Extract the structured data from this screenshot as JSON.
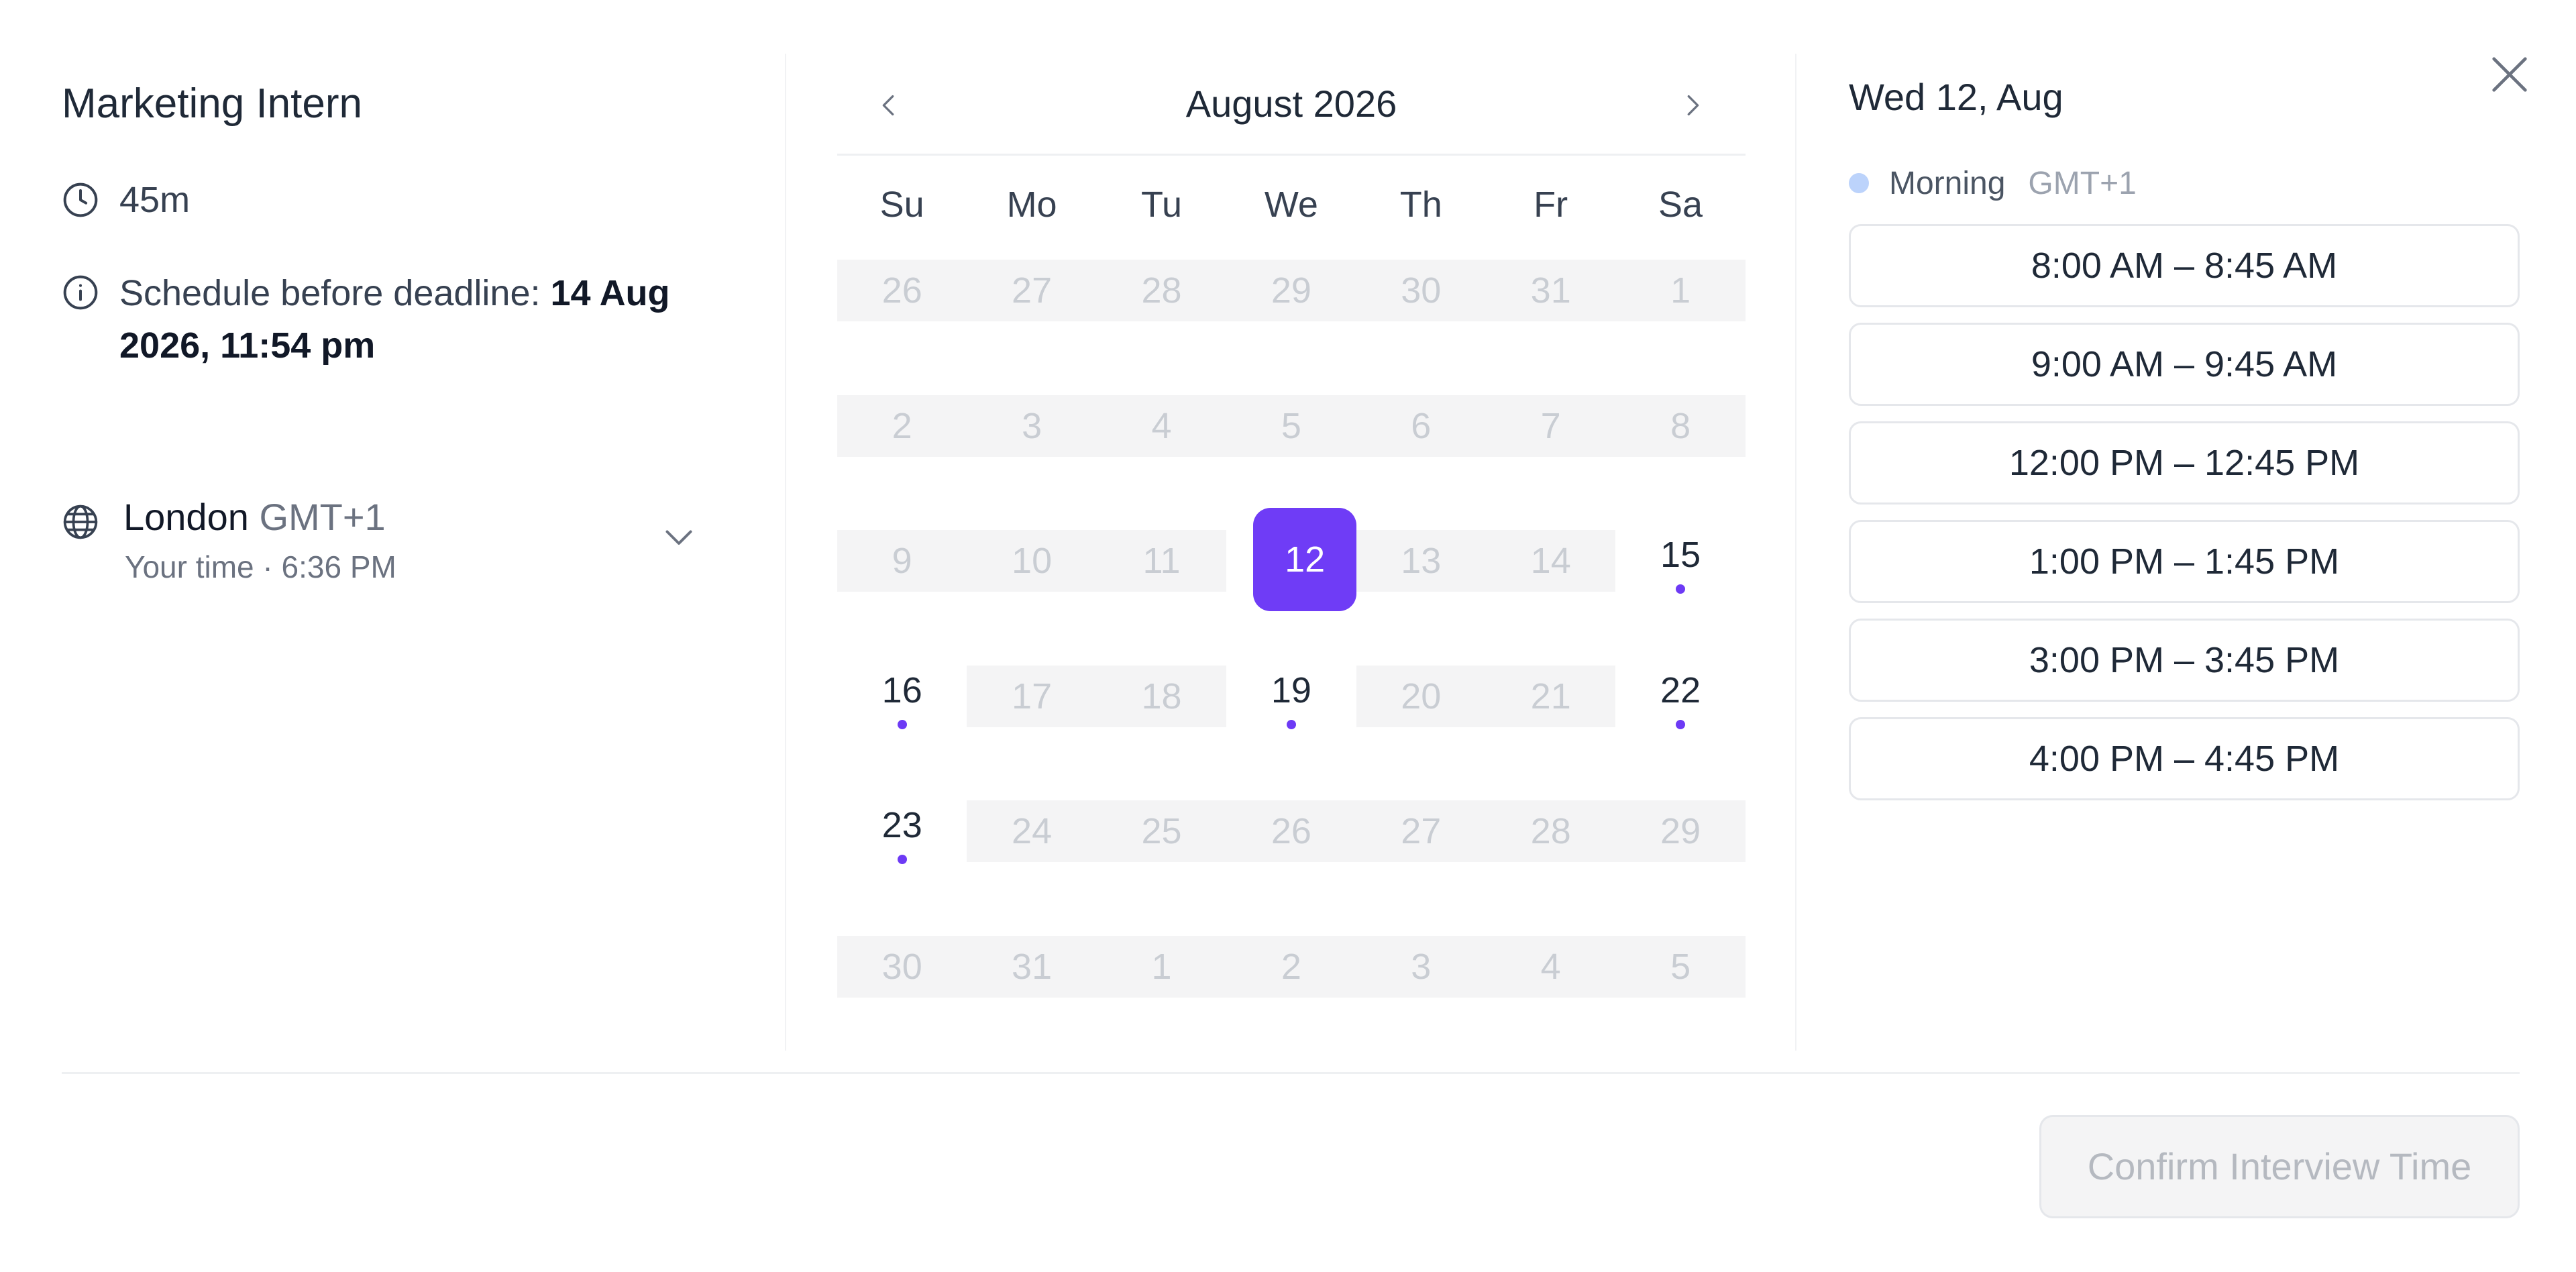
{
  "job": {
    "title": "Marketing Intern",
    "duration": "45m",
    "deadline_label": "Schedule before deadline: ",
    "deadline_value": "14 Aug 2026, 11:54 pm"
  },
  "timezone": {
    "city": "London",
    "offset": "GMT+1",
    "local_time": "Your time · 6:36 PM"
  },
  "calendar": {
    "month_title": "August 2026",
    "weekdays": [
      "Su",
      "Mo",
      "Tu",
      "We",
      "Th",
      "Fr",
      "Sa"
    ],
    "weeks": [
      [
        {
          "label": "26",
          "state": "disabled"
        },
        {
          "label": "27",
          "state": "disabled"
        },
        {
          "label": "28",
          "state": "disabled"
        },
        {
          "label": "29",
          "state": "disabled"
        },
        {
          "label": "30",
          "state": "disabled"
        },
        {
          "label": "31",
          "state": "disabled"
        },
        {
          "label": "1",
          "state": "disabled"
        }
      ],
      [
        {
          "label": "2",
          "state": "disabled"
        },
        {
          "label": "3",
          "state": "disabled"
        },
        {
          "label": "4",
          "state": "disabled"
        },
        {
          "label": "5",
          "state": "disabled"
        },
        {
          "label": "6",
          "state": "disabled"
        },
        {
          "label": "7",
          "state": "disabled"
        },
        {
          "label": "8",
          "state": "disabled"
        }
      ],
      [
        {
          "label": "9",
          "state": "disabled"
        },
        {
          "label": "10",
          "state": "disabled"
        },
        {
          "label": "11",
          "state": "disabled"
        },
        {
          "label": "12",
          "state": "selected"
        },
        {
          "label": "13",
          "state": "disabled"
        },
        {
          "label": "14",
          "state": "disabled"
        },
        {
          "label": "15",
          "state": "available"
        }
      ],
      [
        {
          "label": "16",
          "state": "available"
        },
        {
          "label": "17",
          "state": "disabled"
        },
        {
          "label": "18",
          "state": "disabled"
        },
        {
          "label": "19",
          "state": "available"
        },
        {
          "label": "20",
          "state": "disabled"
        },
        {
          "label": "21",
          "state": "disabled"
        },
        {
          "label": "22",
          "state": "available"
        }
      ],
      [
        {
          "label": "23",
          "state": "available"
        },
        {
          "label": "24",
          "state": "disabled"
        },
        {
          "label": "25",
          "state": "disabled"
        },
        {
          "label": "26",
          "state": "disabled"
        },
        {
          "label": "27",
          "state": "disabled"
        },
        {
          "label": "28",
          "state": "disabled"
        },
        {
          "label": "29",
          "state": "disabled"
        }
      ],
      [
        {
          "label": "30",
          "state": "disabled"
        },
        {
          "label": "31",
          "state": "disabled"
        },
        {
          "label": "1",
          "state": "disabled"
        },
        {
          "label": "2",
          "state": "disabled"
        },
        {
          "label": "3",
          "state": "disabled"
        },
        {
          "label": "4",
          "state": "disabled"
        },
        {
          "label": "5",
          "state": "disabled"
        }
      ]
    ]
  },
  "slots": {
    "date_title": "Wed 12, Aug",
    "period_name": "Morning",
    "period_tz": "GMT+1",
    "times": [
      "8:00 AM – 8:45 AM",
      "9:00 AM – 9:45 AM",
      "12:00 PM – 12:45 PM",
      "1:00 PM – 1:45 PM",
      "3:00 PM – 3:45 PM",
      "4:00 PM – 4:45 PM"
    ]
  },
  "actions": {
    "confirm_label": "Confirm Interview Time"
  },
  "icons": {
    "duration": "clock-icon",
    "deadline": "info-icon",
    "timezone": "globe-icon",
    "timezone_toggle": "chevron-down-icon",
    "prev": "chevron-left-icon",
    "next": "chevron-right-icon",
    "close": "close-icon"
  },
  "colors": {
    "accent": "#6f3cf6",
    "available_dot": "#6d3af5",
    "period_dot": "#bcd3fb",
    "disabled_bg": "#f4f4f5"
  }
}
